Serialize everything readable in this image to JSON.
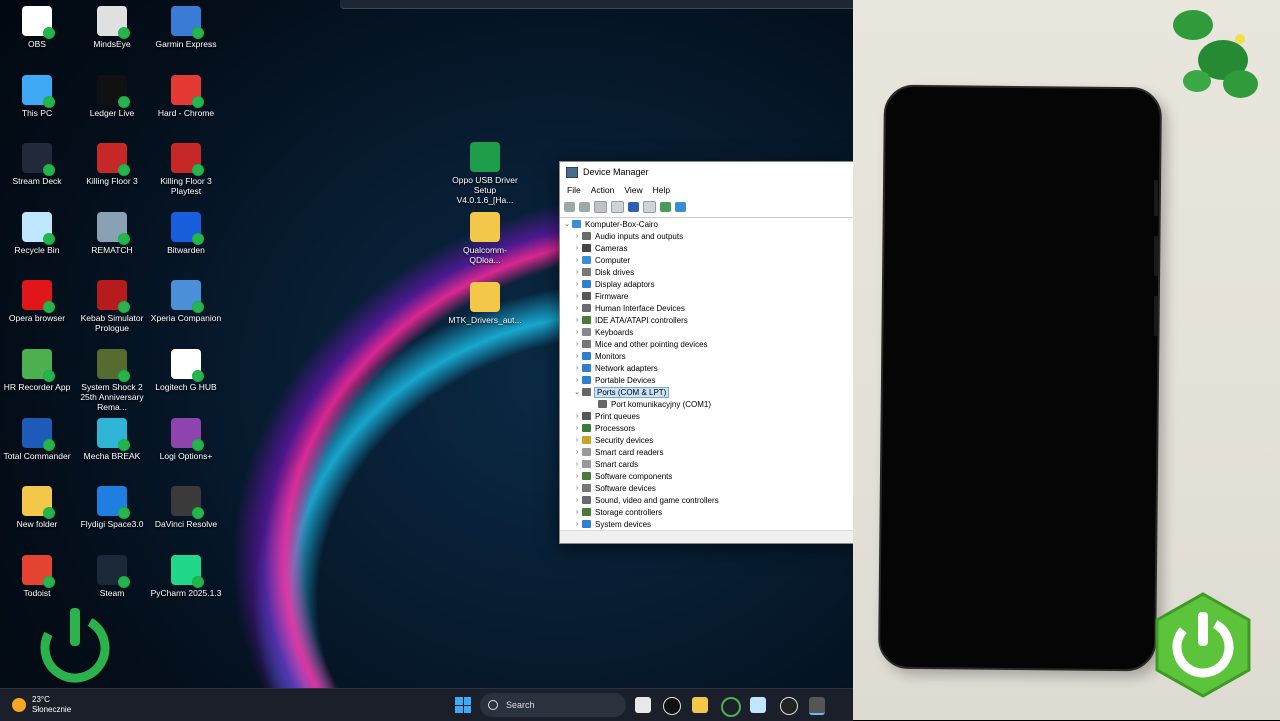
{
  "desktop": {
    "icons": [
      {
        "label": "OBS",
        "icon": "obs-icon",
        "color": "#ffffff"
      },
      {
        "label": "MindsEye",
        "icon": "mindseye-icon",
        "color": "#e0e0e0"
      },
      {
        "label": "Garmin Express",
        "icon": "globe-icon",
        "color": "#3a7bd5"
      },
      {
        "label": "This PC",
        "icon": "monitor-icon",
        "color": "#3fa9f5"
      },
      {
        "label": "Ledger Live",
        "icon": "ledger-icon",
        "color": "#111111"
      },
      {
        "label": "Hard - Chrome",
        "icon": "chrome-icon",
        "color": "#e53935"
      },
      {
        "label": "Stream Deck",
        "icon": "stream-deck-icon",
        "color": "#222a3a"
      },
      {
        "label": "Killing Floor 3",
        "icon": "kf-icon",
        "color": "#c62828"
      },
      {
        "label": "Killing Floor 3 Playtest",
        "icon": "kf-icon",
        "color": "#c62828"
      },
      {
        "label": "Recycle Bin",
        "icon": "recycle-bin-icon",
        "color": "#bfe6ff"
      },
      {
        "label": "REMATCH",
        "icon": "rematch-icon",
        "color": "#8aa0b5"
      },
      {
        "label": "Bitwarden",
        "icon": "bitwarden-icon",
        "color": "#175ddc"
      },
      {
        "label": "Opera browser",
        "icon": "opera-icon",
        "color": "#e0161b"
      },
      {
        "label": "Kebab Simulator Prologue",
        "icon": "kebab-icon",
        "color": "#b71c1c"
      },
      {
        "label": "Xperia Companion",
        "icon": "xperia-icon",
        "color": "#4a8fd8"
      },
      {
        "label": "HR Recorder App",
        "icon": "power-icon",
        "color": "#4caf50"
      },
      {
        "label": "System Shock 2 25th Anniversary Rema...",
        "icon": "shock-icon",
        "color": "#556b2f"
      },
      {
        "label": "Logitech G HUB",
        "icon": "logitech-icon",
        "color": "#ffffff"
      },
      {
        "label": "Total Commander",
        "icon": "floppy-icon",
        "color": "#1e5bb8"
      },
      {
        "label": "Mecha BREAK",
        "icon": "mecha-icon",
        "color": "#2fb4d6"
      },
      {
        "label": "Logi Options+",
        "icon": "logi-icon",
        "color": "#8e44ad"
      },
      {
        "label": "New folder",
        "icon": "folder-icon",
        "color": "#f3c74a"
      },
      {
        "label": "Flydigi Space3.0",
        "icon": "flydigi-icon",
        "color": "#1f7fe0"
      },
      {
        "label": "DaVinci Resolve",
        "icon": "davinci-icon",
        "color": "#3a3a3a"
      },
      {
        "label": "Todoist",
        "icon": "todoist-icon",
        "color": "#e44332"
      },
      {
        "label": "Steam",
        "icon": "steam-icon",
        "color": "#1b2838"
      },
      {
        "label": "PyCharm 2025.1.3",
        "icon": "pycharm-icon",
        "color": "#21d789"
      }
    ],
    "middle_icons": [
      {
        "label": "Oppo USB Driver Setup V4.0.1.6_[Ha...",
        "icon": "oppo-icon",
        "color": "#1e9e4a"
      },
      {
        "label": "Qualcomm-QDloa...",
        "icon": "folder-icon",
        "color": "#f3c74a"
      },
      {
        "label": "MTK_Drivers_aut...",
        "icon": "folder-icon",
        "color": "#f3c74a"
      }
    ]
  },
  "device_manager": {
    "title": "Device Manager",
    "menu": [
      "File",
      "Action",
      "View",
      "Help"
    ],
    "root": "Komputer-Box-Cairo",
    "items": [
      {
        "label": "Audio inputs and outputs",
        "icon": "speaker-icon",
        "color": "#6a6a6a"
      },
      {
        "label": "Cameras",
        "icon": "camera-icon",
        "color": "#444444"
      },
      {
        "label": "Computer",
        "icon": "computer-icon",
        "color": "#3a8ed8"
      },
      {
        "label": "Disk drives",
        "icon": "disk-icon",
        "color": "#777777"
      },
      {
        "label": "Display adaptors",
        "icon": "display-icon",
        "color": "#2f7fd0"
      },
      {
        "label": "Firmware",
        "icon": "chip-icon",
        "color": "#555555"
      },
      {
        "label": "Human Interface Devices",
        "icon": "hid-icon",
        "color": "#6a6a6a"
      },
      {
        "label": "IDE ATA/ATAPI controllers",
        "icon": "ide-icon",
        "color": "#4a7a3a"
      },
      {
        "label": "Keyboards",
        "icon": "keyboard-icon",
        "color": "#888888"
      },
      {
        "label": "Mice and other pointing devices",
        "icon": "mouse-icon",
        "color": "#777777"
      },
      {
        "label": "Monitors",
        "icon": "monitor-icon",
        "color": "#2f7fd0"
      },
      {
        "label": "Network adapters",
        "icon": "network-icon",
        "color": "#2f7fd0"
      },
      {
        "label": "Portable Devices",
        "icon": "portable-icon",
        "color": "#2f7fd0"
      },
      {
        "label": "Ports (COM & LPT)",
        "icon": "port-icon",
        "color": "#666666",
        "expanded": true,
        "selected": true
      },
      {
        "label": "Port komunikacyjny (COM1)",
        "icon": "port-icon",
        "color": "#666666",
        "child": true
      },
      {
        "label": "Print queues",
        "icon": "printer-icon",
        "color": "#555555"
      },
      {
        "label": "Processors",
        "icon": "cpu-icon",
        "color": "#3b7a3b"
      },
      {
        "label": "Security devices",
        "icon": "security-icon",
        "color": "#c9a227"
      },
      {
        "label": "Smart card readers",
        "icon": "smartcard-icon",
        "color": "#999999"
      },
      {
        "label": "Smart cards",
        "icon": "smartcard-icon",
        "color": "#999999"
      },
      {
        "label": "Software components",
        "icon": "component-icon",
        "color": "#4a7a3a"
      },
      {
        "label": "Software devices",
        "icon": "software-icon",
        "color": "#777777"
      },
      {
        "label": "Sound, video and game controllers",
        "icon": "sound-icon",
        "color": "#6a6a6a"
      },
      {
        "label": "Storage controllers",
        "icon": "storage-icon",
        "color": "#4a7a3a"
      },
      {
        "label": "System devices",
        "icon": "system-icon",
        "color": "#2f7fd0"
      }
    ]
  },
  "taskbar": {
    "weather_temp": "23°C",
    "weather_desc": "Słonecznie",
    "search_label": "Search"
  }
}
